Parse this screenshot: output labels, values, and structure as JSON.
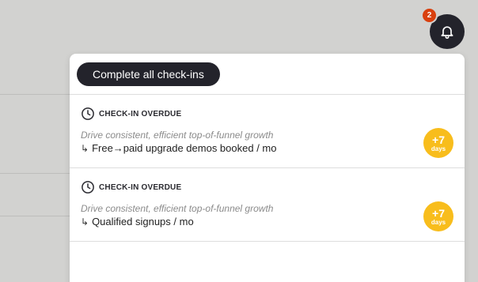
{
  "notifications": {
    "badge_count": "2",
    "complete_all_label": "Complete all check-ins",
    "items": [
      {
        "status": "CHECK-IN OVERDUE",
        "objective": "Drive consistent, efficient top-of-funnel growth",
        "arrow": "↳",
        "key_result": "Free→paid upgrade demos booked / mo",
        "days_value": "+7",
        "days_unit": "days"
      },
      {
        "status": "CHECK-IN OVERDUE",
        "objective": "Drive consistent, efficient top-of-funnel growth",
        "arrow": "↳",
        "key_result": "Qualified signups / mo",
        "days_value": "+7",
        "days_unit": "days"
      }
    ]
  },
  "icons": {
    "bell": "bell-icon",
    "clock": "clock-icon"
  },
  "colors": {
    "badge": "#d9400e",
    "dark": "#23232b",
    "days_badge": "#f8bd1c"
  }
}
